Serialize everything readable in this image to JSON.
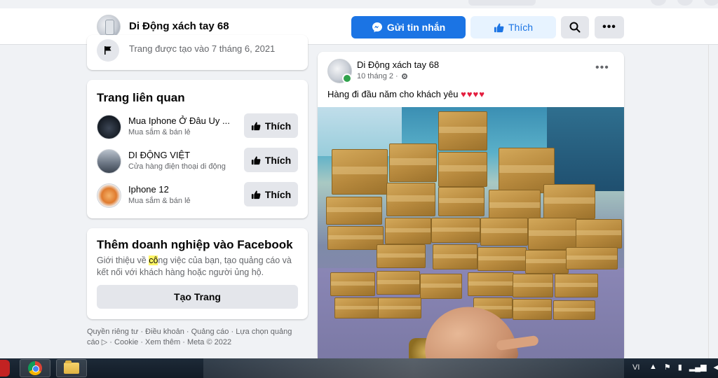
{
  "page": {
    "name": "Di Động xách tay 68",
    "buttons": {
      "message": "Gửi tin nhắn",
      "like": "Thích"
    }
  },
  "intro": {
    "created": "Trang được tạo vào 7 tháng 6, 2021"
  },
  "related": {
    "title": "Trang liên quan",
    "items": [
      {
        "name": "Mua Iphone Ở Đâu Uy ...",
        "category": "Mua sắm & bán lẻ",
        "button": "Thích"
      },
      {
        "name": "DI ĐỘNG VIỆT",
        "category": "Cửa hàng điện thoại di động",
        "button": "Thích"
      },
      {
        "name": "Iphone 12",
        "category": "Mua sắm & bán lẻ",
        "button": "Thích"
      }
    ]
  },
  "business": {
    "title": "Thêm doanh nghiệp vào Facebook",
    "desc_before": "Giới thiệu về ",
    "desc_highlight": "cô",
    "desc_after": "ng việc của bạn, tạo quảng cáo và kết nối với khách hàng hoặc người ủng hộ.",
    "button": "Tạo Trang"
  },
  "footer": {
    "text": "Quyền riêng tư · Điều khoản · Quảng cáo · Lựa chọn quảng cáo ▷ · Cookie · Xem thêm · Meta © 2022"
  },
  "post": {
    "author": "Di Động xách tay 68",
    "date": "10 tháng 2 ·",
    "text": "Hàng đi đầu năm cho khách yêu",
    "hearts": "♥♥♥♥"
  },
  "taskbar": {
    "language": "VI"
  },
  "colors": {
    "brand_blue": "#1b74e4",
    "light_blue": "#e7f3ff",
    "background": "#f0f2f5",
    "button_gray": "#e4e6eb",
    "heart_red": "#e41e3f",
    "online_green": "#31a24c"
  },
  "icons": {
    "messenger": "messenger-icon",
    "like": "thumbs-up-icon",
    "search": "search-icon",
    "more": "more-dots-icon",
    "flag": "flag-icon",
    "globe": "gear-icon"
  }
}
